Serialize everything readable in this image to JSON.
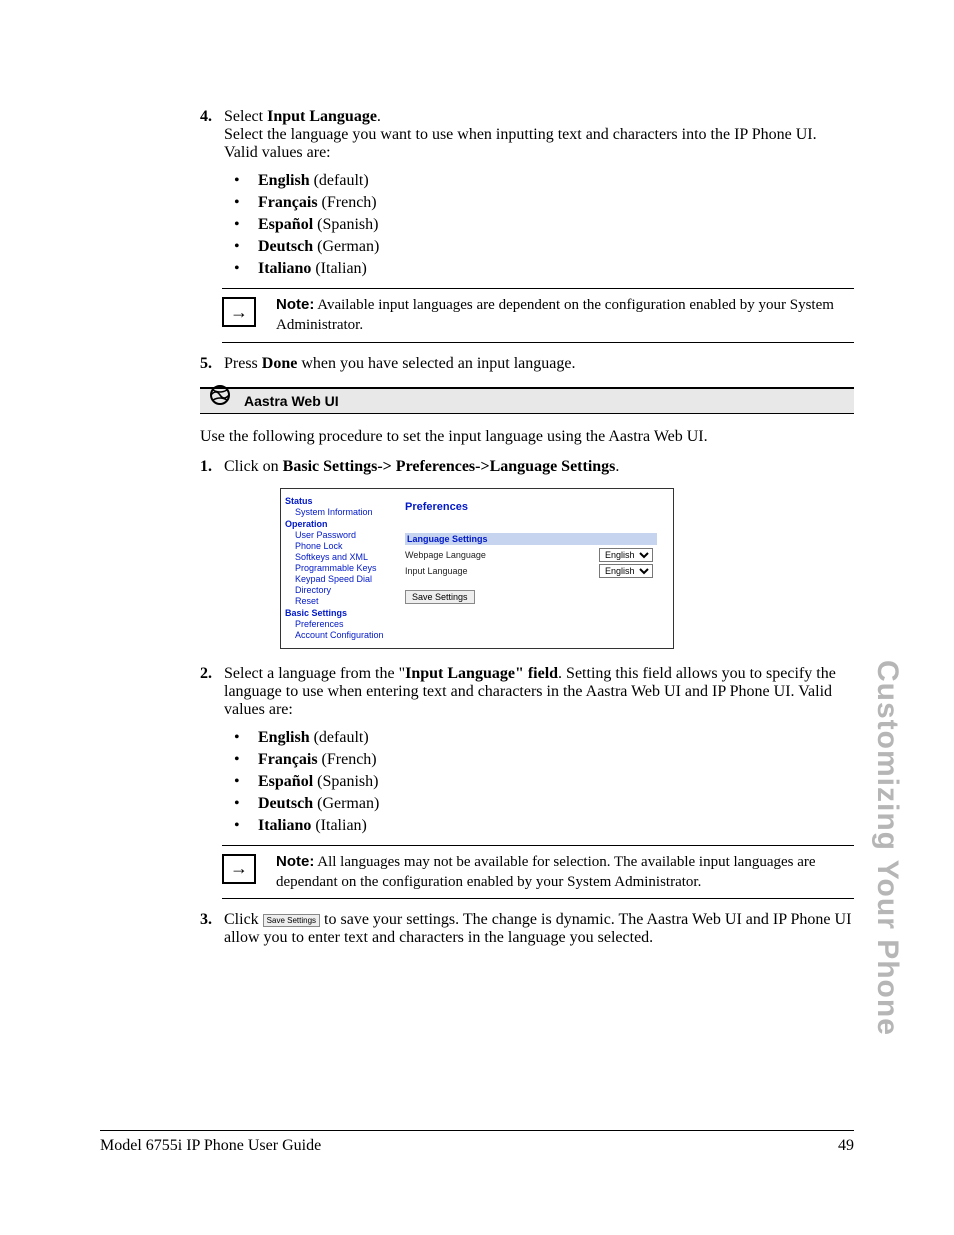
{
  "side_tab": "Customizing Your Phone",
  "step4": {
    "num": "4.",
    "lead": "Select ",
    "bold": "Input Language",
    "trail": ".",
    "desc": "Select the language you want to use when inputting text and characters into the IP Phone UI. Valid values are:"
  },
  "langs": [
    {
      "bold": "English",
      "rest": " (default)"
    },
    {
      "bold": "Français",
      "rest": " (French)"
    },
    {
      "bold": "Español",
      "rest": " (Spanish)"
    },
    {
      "bold": "Deutsch",
      "rest": " (German)"
    },
    {
      "bold": "Italiano",
      "rest": " (Italian)"
    }
  ],
  "note1": {
    "label": "Note:",
    "text": " Available input languages are dependent on the configuration enabled by your System Administrator."
  },
  "step5": {
    "num": "5.",
    "p1": "Press ",
    "bold": "Done",
    "p2": " when you have selected an input language."
  },
  "section_header": "Aastra Web UI",
  "intro": "Use the following procedure to set the input language using the Aastra Web UI.",
  "stepA": {
    "num": "1.",
    "p1": "Click on ",
    "bold": "Basic Settings-> Preferences->Language Settings",
    "p2": "."
  },
  "shot": {
    "nav": {
      "status": "Status",
      "status_items": [
        "System Information"
      ],
      "operation": "Operation",
      "operation_items": [
        "User Password",
        "Phone Lock",
        "Softkeys and XML",
        "Programmable Keys",
        "Keypad Speed Dial",
        "Directory",
        "Reset"
      ],
      "basic": "Basic Settings",
      "basic_items": [
        "Preferences",
        "Account Configuration"
      ]
    },
    "main": {
      "title": "Preferences",
      "section": "Language Settings",
      "fields": [
        {
          "label": "Webpage Language",
          "value": "English"
        },
        {
          "label": "Input Language",
          "value": "English"
        }
      ],
      "save": "Save Settings"
    }
  },
  "stepB": {
    "num": "2.",
    "p1": "Select a language from the \"",
    "bold": "Input Language\" field",
    "p2": ". Setting this field allows you to specify the language to use when entering text and characters in the Aastra Web UI and IP Phone UI. Valid values are:"
  },
  "note2": {
    "label": "Note:",
    "text": " All languages may not be available for selection. The available input languages are dependant on the configuration enabled by your System Administrator."
  },
  "stepC": {
    "num": "3.",
    "p1": "Click ",
    "btn": "Save Settings",
    "p2": " to save your settings. The change is dynamic. The Aastra Web UI and IP Phone UI allow you to enter text and characters in the language you selected."
  },
  "footer": {
    "left": "Model 6755i IP Phone User Guide",
    "right": "49"
  }
}
